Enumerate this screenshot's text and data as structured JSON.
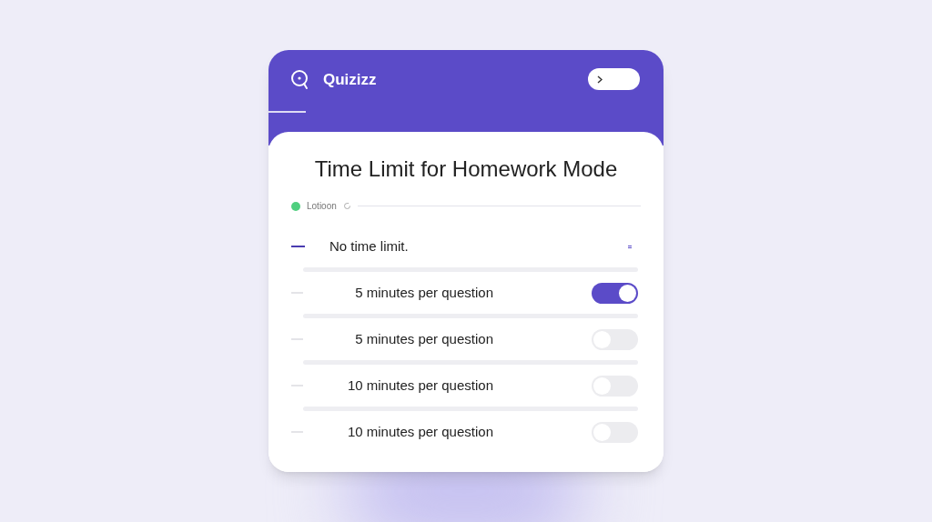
{
  "header": {
    "brand": "Quizizz"
  },
  "title": "Time Limit for Homework Mode",
  "status": {
    "label": "Lotioon",
    "color": "#4fcf7f"
  },
  "options": [
    {
      "kind": "plain",
      "label": "No time limit.",
      "selected": true
    },
    {
      "kind": "toggle",
      "label": "5 minutes per question",
      "selected": false,
      "on": true
    },
    {
      "kind": "toggle",
      "label": "5 minutes per question",
      "selected": false,
      "on": false
    },
    {
      "kind": "toggle",
      "label": "10 minutes per question",
      "selected": false,
      "on": false
    },
    {
      "kind": "toggle",
      "label": "10 minutes per question",
      "selected": false,
      "on": false
    }
  ]
}
